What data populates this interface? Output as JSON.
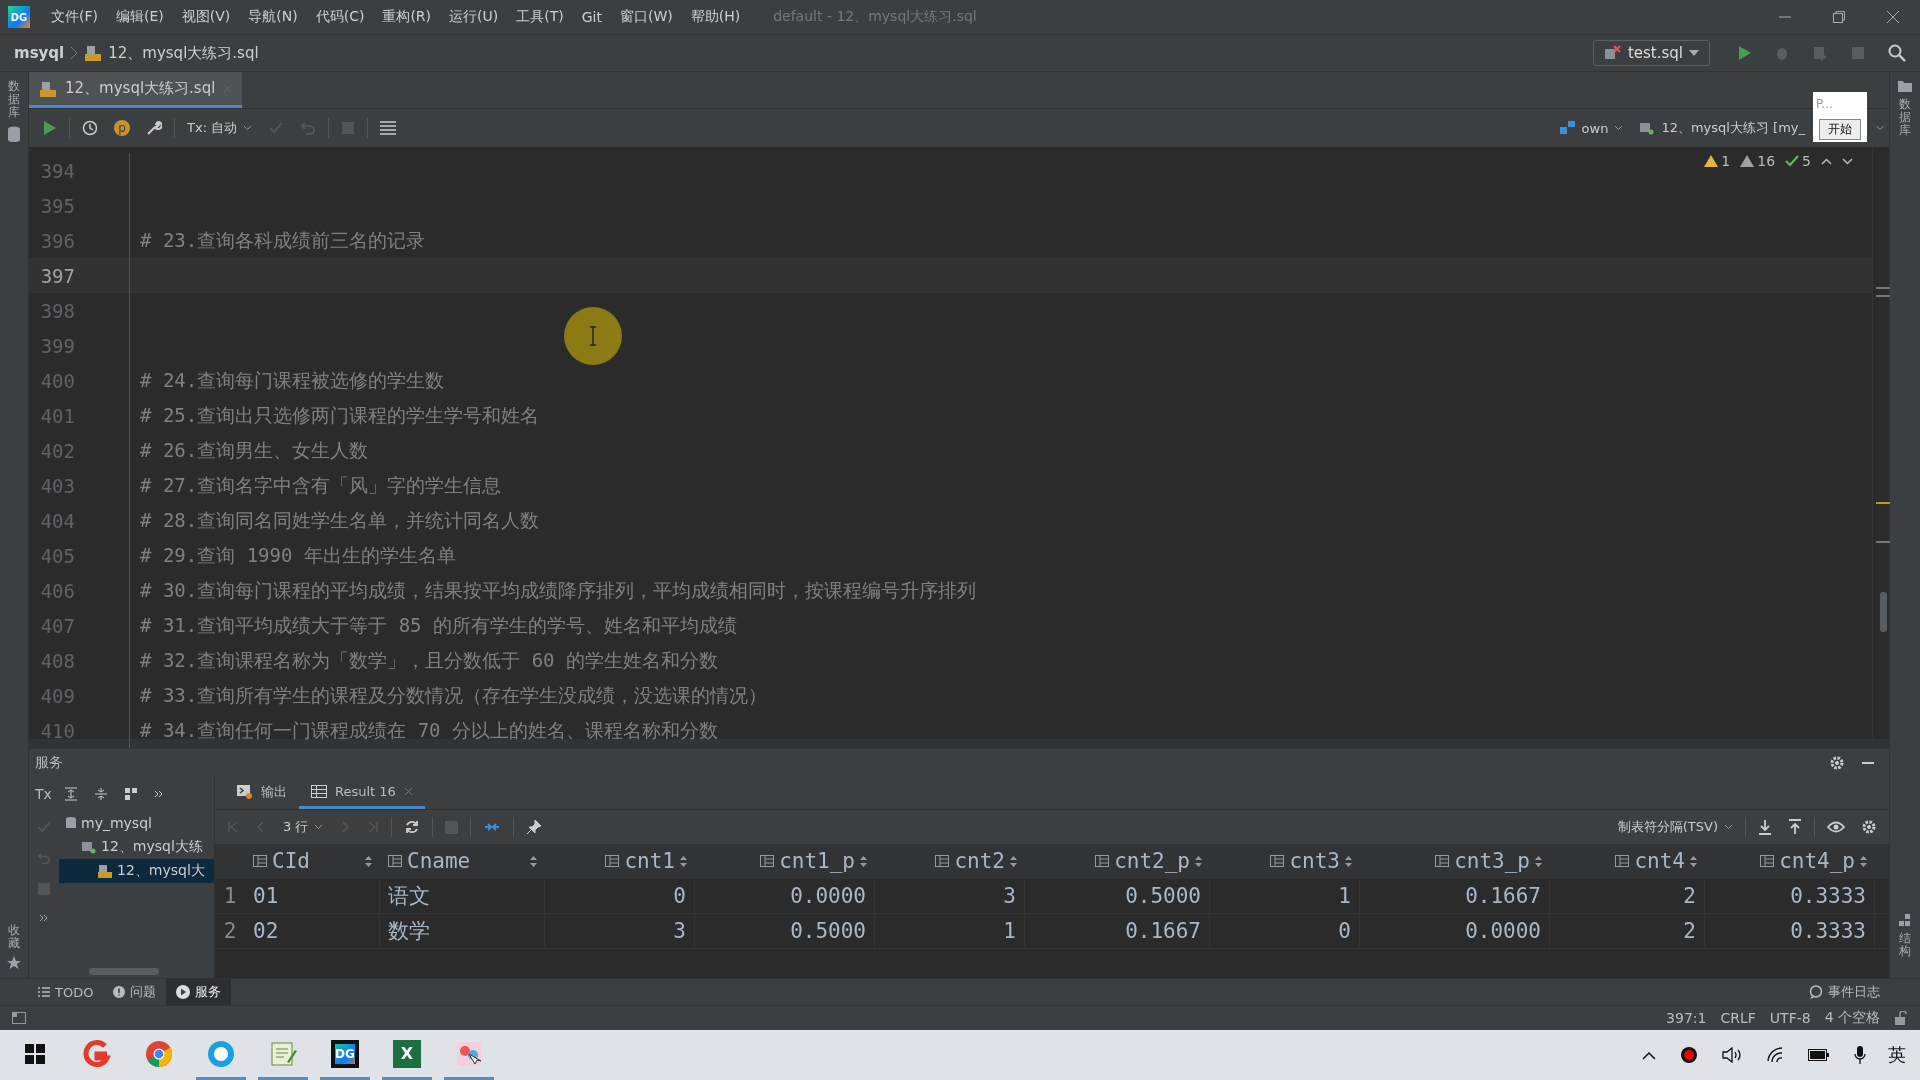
{
  "app_logo": "DG",
  "menu": [
    "文件(F)",
    "编辑(E)",
    "视图(V)",
    "导航(N)",
    "代码(C)",
    "重构(R)",
    "运行(U)",
    "工具(T)",
    "Git",
    "窗口(W)",
    "帮助(H)"
  ],
  "window_title": "default - 12、mysql大练习.sql",
  "breadcrumb": [
    "msyql",
    "12、mysql大练习.sql"
  ],
  "run_config": "test.sql",
  "left_strip": {
    "top": "数据库",
    "bottom": "收藏"
  },
  "right_strip": {
    "top": "数据库",
    "bottom": "结构"
  },
  "editor_tabs": [
    {
      "label": "12、mysql大练习.sql",
      "selected": true
    }
  ],
  "editor_toolbar": {
    "badge": "p",
    "tx": "Tx: 自动",
    "schema": "own",
    "session": "12、mysql大练习 [my_"
  },
  "popup": {
    "text": "P...",
    "button": "开始"
  },
  "inspections": [
    {
      "kind": "error",
      "count": "1"
    },
    {
      "kind": "warning",
      "count": "16"
    },
    {
      "kind": "ok",
      "count": "5"
    }
  ],
  "editor": {
    "lines": [
      {
        "number": "394",
        "current": false
      },
      {
        "number": "395",
        "current": false
      },
      {
        "number": "396",
        "text": "# 23.查询各科成绩前三名的记录",
        "current": false
      },
      {
        "number": "397",
        "current": true
      },
      {
        "number": "398",
        "current": false
      },
      {
        "number": "399",
        "current": false
      },
      {
        "number": "400",
        "text": "# 24.查询每门课程被选修的学生数",
        "current": false
      },
      {
        "number": "401",
        "text": "# 25.查询出只选修两门课程的学生学号和姓名",
        "current": false
      },
      {
        "number": "402",
        "text": "# 26.查询男生、女生人数",
        "current": false
      },
      {
        "number": "403",
        "text": "# 27.查询名字中含有「风」字的学生信息",
        "current": false
      },
      {
        "number": "404",
        "text": "# 28.查询同名同姓学生名单，并统计同名人数",
        "current": false
      },
      {
        "number": "405",
        "text": "# 29.查询 1990 年出生的学生名单",
        "current": false
      },
      {
        "number": "406",
        "text": "# 30.查询每门课程的平均成绩，结果按平均成绩降序排列，平均成绩相同时，按课程编号升序排列",
        "current": false
      },
      {
        "number": "407",
        "text": "# 31.查询平均成绩大于等于 85 的所有学生的学号、姓名和平均成绩",
        "current": false
      },
      {
        "number": "408",
        "text": "# 32.查询课程名称为「数学」，且分数低于 60 的学生姓名和分数",
        "current": false
      },
      {
        "number": "409",
        "text": "# 33.查询所有学生的课程及分数情况（存在学生没成绩，没选课的情况）",
        "current": false
      },
      {
        "number": "410",
        "text": "# 34.查询任何一门课程成绩在 70 分以上的姓名、课程名称和分数",
        "current": false
      }
    ]
  },
  "services": {
    "title": "服务",
    "tx": "Tx",
    "tree": [
      {
        "label": "my_mysql",
        "kind": "connection",
        "selected": false,
        "children": [
          {
            "label": "12、mysql大练",
            "kind": "session",
            "selected": false,
            "children": [
              {
                "label": "12、mysql大",
                "kind": "file",
                "selected": true
              }
            ]
          }
        ]
      }
    ],
    "tabs": [
      {
        "label": "输出",
        "kind": "output",
        "selected": false
      },
      {
        "label": "Result 16",
        "kind": "table",
        "selected": true
      }
    ],
    "row_count": "3 行",
    "export_format": "制表符分隔(TSV)",
    "table": {
      "columns": [
        {
          "name": "CId"
        },
        {
          "name": "Cname"
        },
        {
          "name": "cnt1"
        },
        {
          "name": "cnt1_p"
        },
        {
          "name": "cnt2"
        },
        {
          "name": "cnt2_p"
        },
        {
          "name": "cnt3"
        },
        {
          "name": "cnt3_p"
        },
        {
          "name": "cnt4"
        },
        {
          "name": "cnt4_p"
        }
      ],
      "rows": [
        {
          "number": "1",
          "cells": [
            "01",
            "语文",
            "0",
            "0.0000",
            "3",
            "0.5000",
            "1",
            "0.1667",
            "2",
            "0.3333"
          ]
        },
        {
          "number": "2",
          "cells": [
            "02",
            "数学",
            "3",
            "0.5000",
            "1",
            "0.1667",
            "0",
            "0.0000",
            "2",
            "0.3333"
          ]
        }
      ]
    }
  },
  "tool_tabs": [
    {
      "label": "TODO",
      "kind": "list",
      "selected": false
    },
    {
      "label": "问题",
      "kind": "info",
      "selected": false
    },
    {
      "label": "服务",
      "kind": "play",
      "selected": true
    }
  ],
  "event_log": "事件日志",
  "status": [
    "397:1",
    "CRLF",
    "UTF-8",
    "4 个空格"
  ],
  "taskbar": [
    {
      "kind": "start",
      "running": false
    },
    {
      "kind": "red",
      "running": false
    },
    {
      "kind": "chrome",
      "running": false
    },
    {
      "kind": "browser",
      "running": true
    },
    {
      "kind": "notepad",
      "running": true
    },
    {
      "kind": "datagrip",
      "label": "DG",
      "running": true
    },
    {
      "kind": "excel",
      "label": "X",
      "running": true
    },
    {
      "kind": "paint",
      "running": true
    }
  ],
  "tray_ime": "英"
}
